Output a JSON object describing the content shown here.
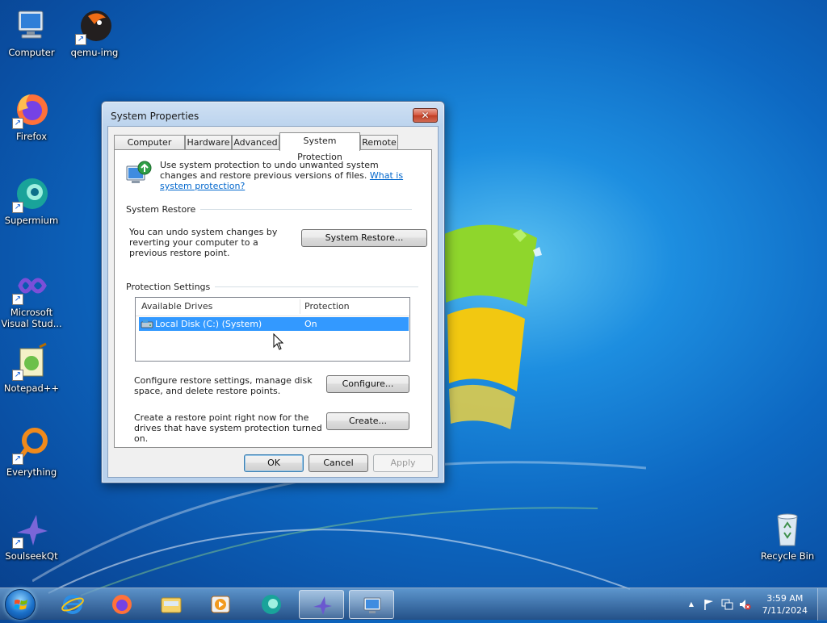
{
  "desktop": {
    "icons": [
      {
        "label": "Computer"
      },
      {
        "label": "qemu-img"
      },
      {
        "label": "Firefox"
      },
      {
        "label": "Supermium"
      },
      {
        "label": "Microsoft Visual Stud..."
      },
      {
        "label": "Notepad++"
      },
      {
        "label": "Everything"
      },
      {
        "label": "SoulseekQt"
      },
      {
        "label": "Recycle Bin"
      }
    ]
  },
  "window": {
    "title": "System Properties",
    "close_glyph": "✕",
    "tabs": [
      {
        "label": "Computer Name"
      },
      {
        "label": "Hardware"
      },
      {
        "label": "Advanced"
      },
      {
        "label": "System Protection"
      },
      {
        "label": "Remote"
      }
    ],
    "intro": {
      "text": "Use system protection to undo unwanted system changes and restore previous versions of files.",
      "link": "What is system protection?"
    },
    "system_restore": {
      "title": "System Restore",
      "description": "You can undo system changes by reverting your computer to a previous restore point.",
      "button": "System Restore..."
    },
    "protection_settings": {
      "title": "Protection Settings",
      "columns": [
        "Available Drives",
        "Protection"
      ],
      "rows": [
        {
          "drive": "Local Disk (C:) (System)",
          "protection": "On"
        }
      ],
      "configure_text": "Configure restore settings, manage disk space, and delete restore points.",
      "configure_button": "Configure...",
      "create_text": "Create a restore point right now for the drives that have system protection turned on.",
      "create_button": "Create..."
    },
    "buttons": {
      "ok": "OK",
      "cancel": "Cancel",
      "apply": "Apply"
    }
  },
  "taskbar": {
    "clock": {
      "time": "3:59 AM",
      "date": "7/11/2024"
    },
    "tray_expand": "▲"
  },
  "colors": {
    "selection": "#3399ff",
    "link": "#0066cc",
    "close_button": "#c03d23"
  }
}
